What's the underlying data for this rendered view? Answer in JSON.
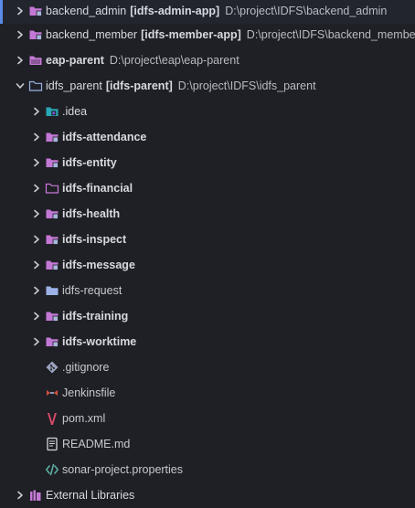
{
  "tree": {
    "top_items": [
      {
        "name": "backend_admin",
        "module": "[idfs-admin-app]",
        "path": "D:\\project\\IDFS\\backend_admin"
      },
      {
        "name": "backend_member",
        "module": "[idfs-member-app]",
        "path": "D:\\project\\IDFS\\backend_member"
      },
      {
        "name": "eap-parent",
        "module": "",
        "path": "D:\\project\\eap\\eap-parent"
      },
      {
        "name": "idfs_parent",
        "module": "[idfs-parent]",
        "path": "D:\\project\\IDFS\\idfs_parent"
      }
    ],
    "children": [
      {
        "name": ".idea"
      },
      {
        "name": "idfs-attendance"
      },
      {
        "name": "idfs-entity"
      },
      {
        "name": "idfs-financial"
      },
      {
        "name": "idfs-health"
      },
      {
        "name": "idfs-inspect"
      },
      {
        "name": "idfs-message"
      },
      {
        "name": "idfs-request"
      },
      {
        "name": "idfs-training"
      },
      {
        "name": "idfs-worktime"
      },
      {
        "name": ".gitignore"
      },
      {
        "name": "Jenkinsfile"
      },
      {
        "name": "pom.xml"
      },
      {
        "name": "README.md"
      },
      {
        "name": "sonar-project.properties"
      }
    ],
    "external_libraries": {
      "name": "External Libraries"
    }
  },
  "colors": {
    "background": "#1f2025",
    "selection": "#22252d",
    "selection_accent": "#5a8be8",
    "module_folder": "#c478d6",
    "plain_folder": "#9cb2e6",
    "idea_folder": "#2aa7b7",
    "git": "#9aa3bd",
    "jenkins": "#d5533f",
    "maven": "#d94b6b",
    "code": "#5fb3a6"
  },
  "icons": {
    "expanded": "chevron-down-icon",
    "collapsed": "chevron-right-icon",
    "module_folder": "module-folder-icon",
    "plain_folder": "folder-icon",
    "idea_folder": "idea-folder-icon",
    "gitignore": "git-icon",
    "jenkinsfile": "jenkins-icon",
    "pom": "maven-icon",
    "readme": "readme-icon",
    "sonar": "code-file-icon",
    "libraries": "library-icon"
  }
}
